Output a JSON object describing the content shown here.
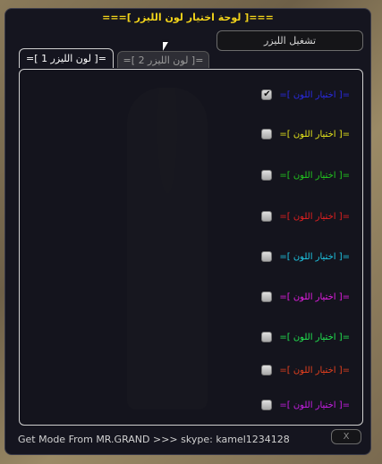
{
  "window": {
    "title": "===[ لوحة اختيار لون الليزر ]===",
    "toggle_button": "تشغيل الليزر"
  },
  "tabs": [
    {
      "label": "=[ لون الليزر 1 ]=",
      "active": true
    },
    {
      "label": "=[ لون الليزر 2 ]=",
      "active": false
    }
  ],
  "options": [
    {
      "label": "=[ اختيار اللون ]=",
      "color": "#2a2ae6",
      "checked": true
    },
    {
      "label": "=[ اختيار اللون ]=",
      "color": "#e6e61a",
      "checked": false
    },
    {
      "label": "=[ اختيار اللون ]=",
      "color": "#22c81e",
      "checked": false
    },
    {
      "label": "=[ اختيار اللون ]=",
      "color": "#e62020",
      "checked": false
    },
    {
      "label": "=[ اختيار اللون ]=",
      "color": "#1ec8e6",
      "checked": false
    },
    {
      "label": "=[ اختيار اللون ]=",
      "color": "#e61ee6",
      "checked": false
    },
    {
      "label": "=[ اختيار اللون ]=",
      "color": "#22e650",
      "checked": false
    },
    {
      "label": "=[ اختيار اللون ]=",
      "color": "#e6401e",
      "checked": false
    },
    {
      "label": "=[ اختيار اللون ]=",
      "color": "#c81ee6",
      "checked": false
    }
  ],
  "footer": {
    "credit": "Get Mode From MR.GRAND >>> skype: kamel1234128",
    "close_label": "X"
  },
  "icons": {
    "checkmark": "✔"
  }
}
